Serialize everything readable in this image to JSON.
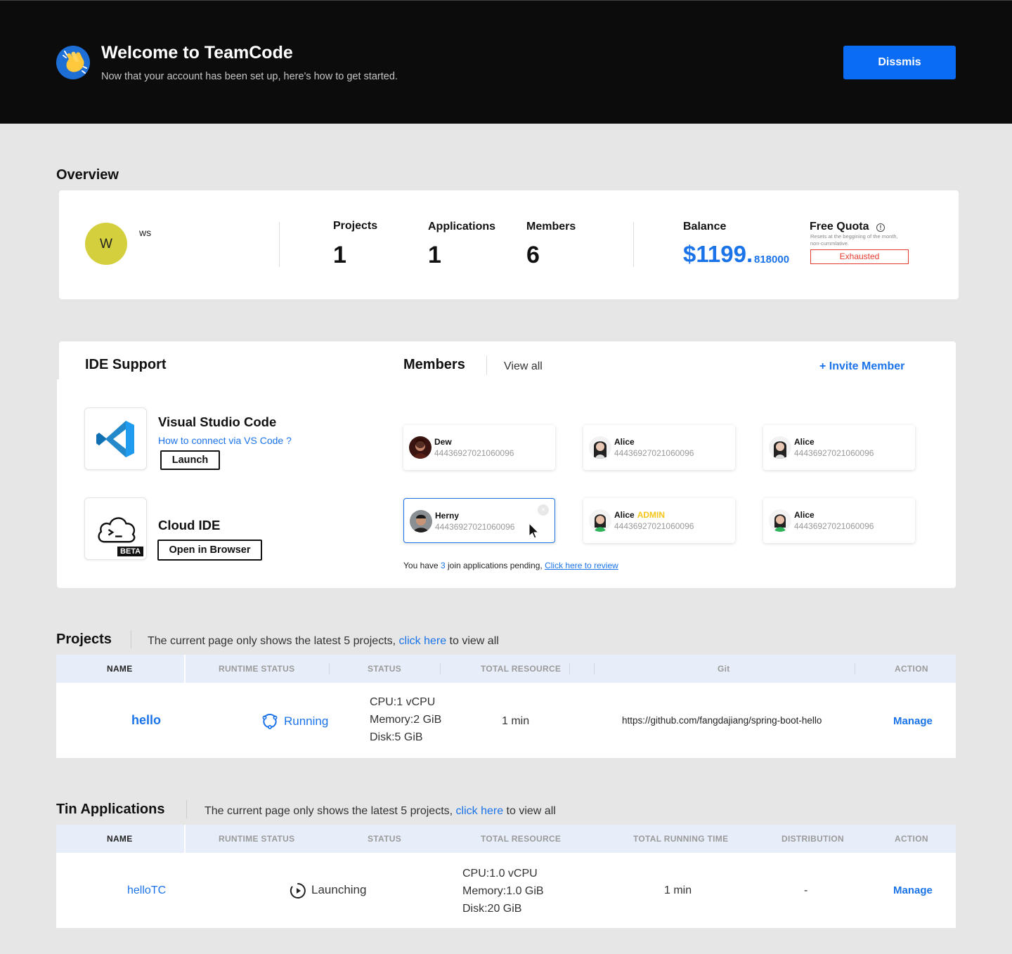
{
  "hero": {
    "title": "Welcome to TeamCode",
    "subtitle": "Now that your account has been set up, here's how to get started.",
    "dismiss_label": "Dissmis",
    "icon": "clapping-hands-icon"
  },
  "overview": {
    "title": "Overview",
    "avatar_initial": "W",
    "username": "ws",
    "projects_label": "Projects",
    "projects_value": "1",
    "applications_label": "Applications",
    "applications_value": "1",
    "members_label": "Members",
    "members_value": "6",
    "balance_label": "Balance",
    "balance_main": "$1199.",
    "balance_decimal": "818000",
    "quota_label": "Free Quota",
    "quota_note": "Resets at the beggining of the month, non-cummlative.",
    "quota_status": "Exhausted"
  },
  "ide": {
    "title": "IDE  Support",
    "vscode_name": "Visual Studio Code",
    "vscode_link": "How to connect via  VS Code  ?",
    "vscode_button": "Launch",
    "cloud_name": "Cloud IDE",
    "cloud_badge": "BETA",
    "cloud_button": "Open in Browser"
  },
  "members": {
    "title": "Members",
    "view_all": "View all",
    "invite": "+ Invite  Member",
    "list": [
      {
        "name": "Dew",
        "id": "44436927021060096",
        "role": ""
      },
      {
        "name": "Alice",
        "id": "44436927021060096",
        "role": ""
      },
      {
        "name": "Alice",
        "id": "44436927021060096",
        "role": ""
      },
      {
        "name": "Herny",
        "id": "44436927021060096",
        "role": ""
      },
      {
        "name": "Alice",
        "id": "44436927021060096",
        "role": "ADMIN"
      },
      {
        "name": "Alice",
        "id": "44436927021060096",
        "role": ""
      }
    ],
    "pending_prefix": "You have ",
    "pending_count": "3",
    "pending_suffix": " join applications pending, ",
    "pending_link": "Click here to review"
  },
  "projects": {
    "title": "Projects",
    "note_prefix": "The current page only shows the latest 5 projects, ",
    "note_link": "click here",
    "note_suffix": " to view all",
    "columns": [
      "NAME",
      "RUNTIME STATUS",
      "STATUS",
      "TOTAL RESOURCE",
      "Git",
      "ACTION"
    ],
    "row": {
      "name": "hello",
      "runtime_status": "Running",
      "cpu": "CPU:1 vCPU",
      "memory": "Memory:2 GiB",
      "disk": "Disk:5 GiB",
      "total_resource": "1 min",
      "git": "https://github.com/fangdajiang/spring-boot-hello",
      "action": "Manage"
    }
  },
  "applications": {
    "title": "Tin Applications",
    "note_prefix": "The current page only shows the latest 5 projects, ",
    "note_link": "click here",
    "note_suffix": " to view all",
    "columns": [
      "NAME",
      "RUNTIME STATUS",
      "STATUS",
      "TOTAL RESOURCE",
      "TOTAL RUNNING TIME",
      "DISTRIBUTION",
      "ACTION"
    ],
    "row": {
      "name": "helloTC",
      "runtime_status": "Launching",
      "cpu": "CPU:1.0 vCPU",
      "memory": "Memory:1.0 GiB",
      "disk": "Disk:20 GiB",
      "running_time": "1 min",
      "distribution": "-",
      "action": "Manage"
    }
  },
  "colors": {
    "accent": "#1a73e8",
    "button": "#0a6cf5",
    "hero_bg": "#0c0c0c",
    "danger": "#e5392f",
    "admin": "#f5c518"
  }
}
